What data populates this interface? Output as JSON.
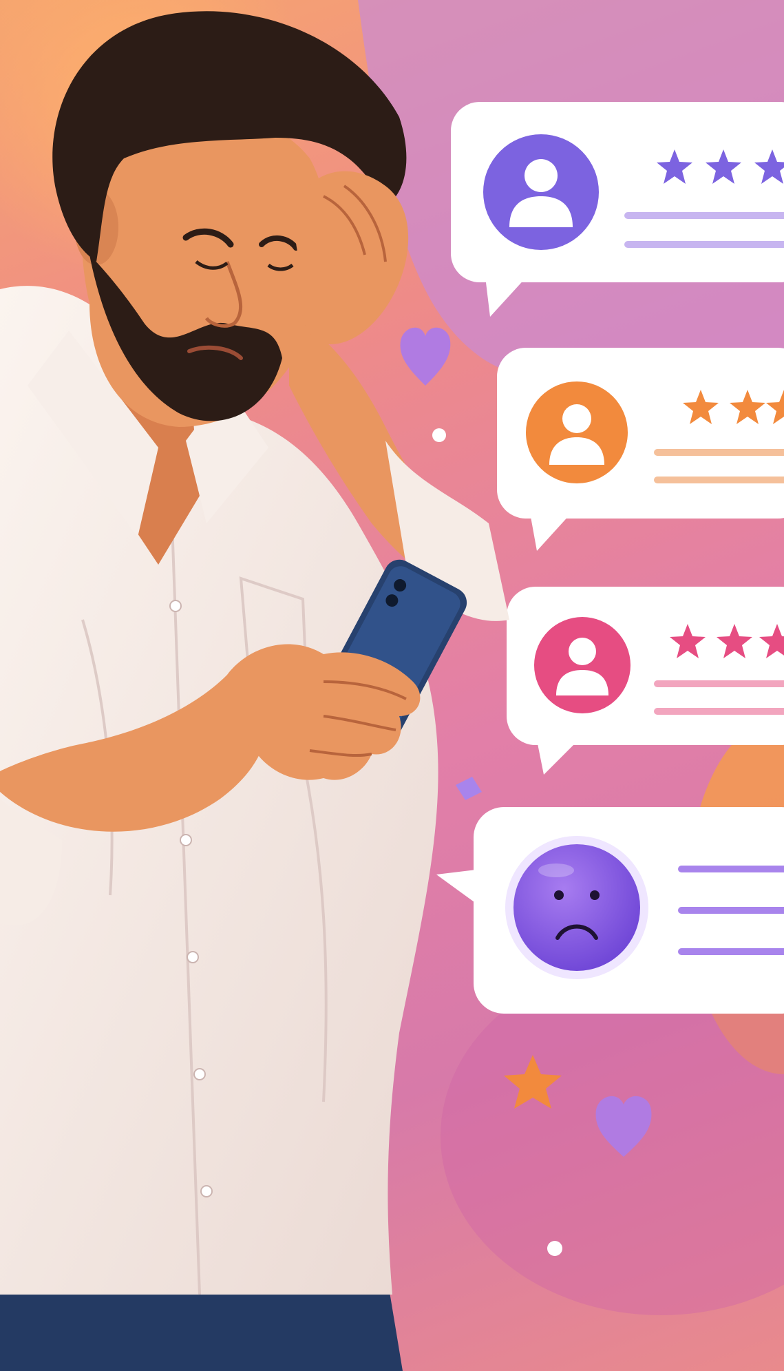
{
  "colors": {
    "bg_top": "#f6a56f",
    "bg_mid": "#e27fa8",
    "bg_purple": "#c98ad6",
    "shirt": "#f6ece6",
    "skin": "#e99660",
    "hair": "#2c1c16",
    "phone": "#27416e",
    "purple": "#7c63e0",
    "orange": "#f28a3d",
    "pink": "#e64d82",
    "sad_face": "#8b60e3"
  },
  "reviews": [
    {
      "avatar_color": "#7c63e0",
      "stars_visible": 3,
      "line_color": "#c7b5f0",
      "icon": "user-icon"
    },
    {
      "avatar_color": "#f28a3d",
      "stars_visible": 2,
      "line_color": "#f5c09a",
      "icon": "user-icon"
    },
    {
      "avatar_color": "#e64d82",
      "stars_visible": 3,
      "line_color": "#f2a5be",
      "icon": "user-icon"
    },
    {
      "avatar_color": "#8b60e3",
      "stars_visible": 0,
      "line_color": "#a884ec",
      "icon": "sad-face-icon"
    }
  ]
}
